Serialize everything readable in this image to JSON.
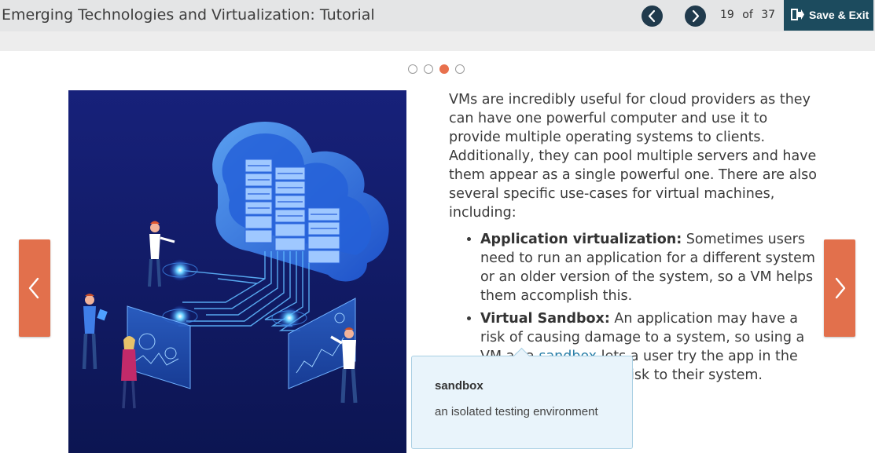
{
  "header": {
    "title": "Emerging Technologies and Virtualization: Tutorial",
    "current_page": "19",
    "of_label": "of",
    "total_pages": "37",
    "save_exit_label": "Save & Exit"
  },
  "carousel": {
    "dot_count": 4,
    "active_index": 2
  },
  "content": {
    "intro": "VMs are incredibly useful for cloud providers as they can have one powerful computer and use it to provide multiple operating systems to clients. Additionally, they can pool multiple servers and have them appear as a single powerful one. There are also several specific use-cases for virtual machines, including:",
    "bullets": [
      {
        "heading": "Application virtualization:",
        "text": " Sometimes users need to run an application for a different system or an older version of the system, so a VM helps them accomplish this."
      },
      {
        "heading": "Virtual Sandbox:",
        "text_before": " An application may have a risk of causing damage to a system, so using a VM as a ",
        "term": "sandbox",
        "text_after": " lets a user try the app in the VM without posing a risk to their system."
      }
    ]
  },
  "tooltip": {
    "term": "sandbox",
    "definition": "an isolated testing environment"
  },
  "colors": {
    "accent_orange": "#e2704c",
    "nav_dark": "#203a4c",
    "save_button": "#1c4b5e",
    "link_blue": "#2a7fa8",
    "tooltip_bg": "#e9f4fb"
  },
  "icons": {
    "prev_page": "chevron-left-icon",
    "next_page": "chevron-right-icon",
    "save_exit": "exit-door-icon",
    "slide_prev": "chevron-left-icon",
    "slide_next": "chevron-right-icon"
  }
}
